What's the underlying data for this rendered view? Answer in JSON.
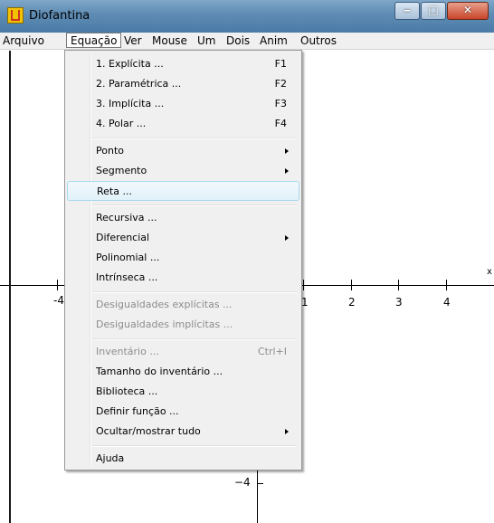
{
  "window": {
    "title": "Diofantina",
    "minimize_label": "‒",
    "maximize_label": "□",
    "close_label": "✕"
  },
  "menubar": {
    "items": [
      "Arquivo",
      "Equação",
      "Ver",
      "Mouse",
      "Um",
      "Dois",
      "Anim",
      "Outros"
    ],
    "active": "Equação"
  },
  "dropdown": {
    "items": [
      {
        "label": "1. Explícita ...",
        "shortcut": "F1"
      },
      {
        "label": "2. Paramétrica ...",
        "shortcut": "F2"
      },
      {
        "label": "3. Implícita ...",
        "shortcut": "F3"
      },
      {
        "label": "4. Polar ...",
        "shortcut": "F4"
      },
      {
        "label": "Ponto",
        "submenu": true
      },
      {
        "label": "Segmento",
        "submenu": true
      },
      {
        "label": "Reta ...",
        "hover": true
      },
      {
        "label": "Recursiva ..."
      },
      {
        "label": "Diferencial",
        "submenu": true
      },
      {
        "label": "Polinomial ..."
      },
      {
        "label": "Intrínseca ..."
      },
      {
        "label": "Desigualdades explícitas ...",
        "disabled": true
      },
      {
        "label": "Desigualdades implícitas ...",
        "disabled": true
      },
      {
        "label": "Inventário ...",
        "shortcut": "Ctrl+I",
        "disabled": true
      },
      {
        "label": "Tamanho do inventário ..."
      },
      {
        "label": "Biblioteca ..."
      },
      {
        "label": "Definir função ..."
      },
      {
        "label": "Ocultar/mostrar tudo",
        "submenu": true
      },
      {
        "label": "Ajuda"
      }
    ]
  },
  "graph": {
    "x_axis_label": "x",
    "x_ticks": [
      "-4",
      "1",
      "2",
      "3",
      "4"
    ],
    "y_tick_label": "−4"
  }
}
